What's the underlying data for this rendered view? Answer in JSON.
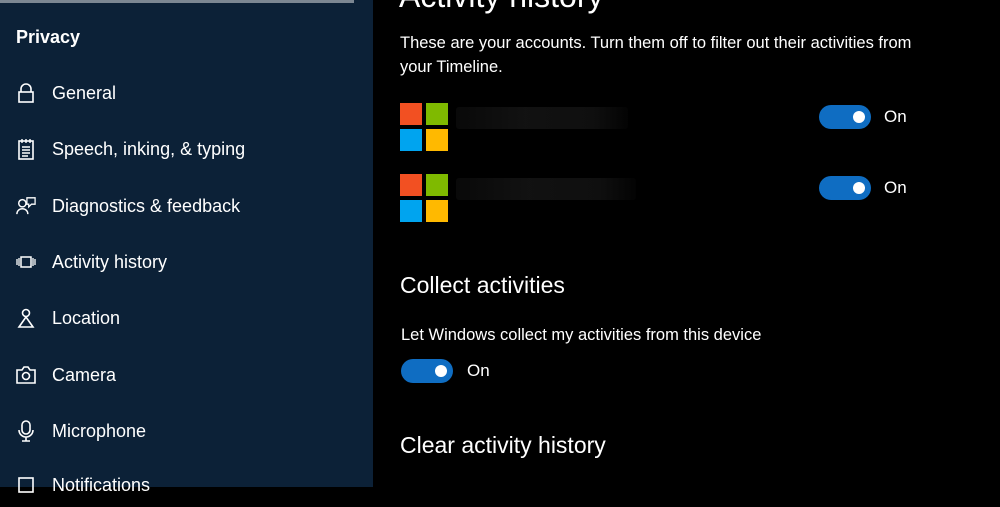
{
  "sidebar": {
    "section_title": "Privacy",
    "items": [
      {
        "label": "General",
        "icon": "lock-icon"
      },
      {
        "label": "Speech, inking, & typing",
        "icon": "notepad-icon"
      },
      {
        "label": "Diagnostics & feedback",
        "icon": "feedback-person-icon"
      },
      {
        "label": "Activity history",
        "icon": "timeline-icon"
      },
      {
        "label": "Location",
        "icon": "location-person-icon"
      },
      {
        "label": "Camera",
        "icon": "camera-icon"
      },
      {
        "label": "Microphone",
        "icon": "microphone-icon"
      },
      {
        "label": "Notifications",
        "icon": "notifications-icon"
      }
    ]
  },
  "main": {
    "page_title": "Activity history",
    "accounts_description": "These are your accounts. Turn them off to filter out their activities from your Timeline.",
    "accounts": [
      {
        "toggle_state": "On"
      },
      {
        "toggle_state": "On"
      }
    ],
    "collect": {
      "heading": "Collect activities",
      "label": "Let Windows collect my activities from this device",
      "toggle_state": "On"
    },
    "clear": {
      "heading": "Clear activity history"
    }
  },
  "colors": {
    "sidebar_bg": "#0c2137",
    "content_bg": "#000000",
    "toggle_on": "#0f6dc2",
    "ms_red": "#f25022",
    "ms_green": "#7fba00",
    "ms_blue": "#00a4ef",
    "ms_yellow": "#ffb900"
  }
}
